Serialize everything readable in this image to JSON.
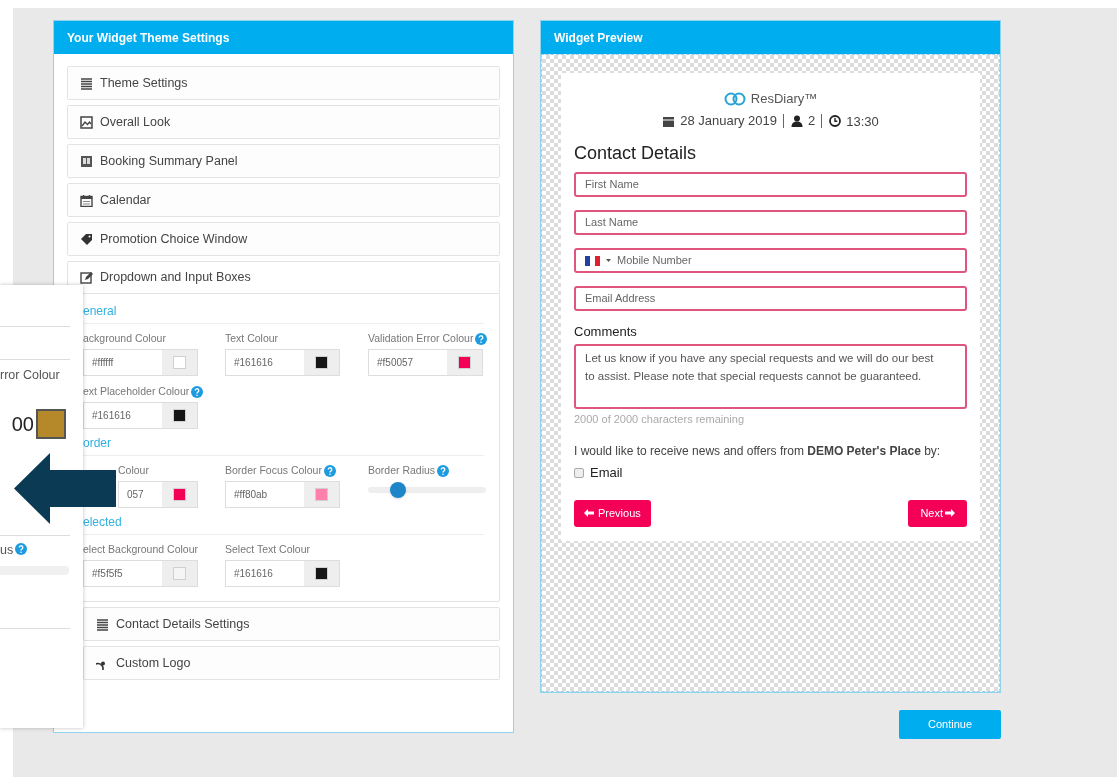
{
  "settings_panel": {
    "title": "Your Widget Theme Settings",
    "sections": [
      {
        "label": "Theme Settings",
        "expanded": false
      },
      {
        "label": "Overall Look",
        "expanded": false
      },
      {
        "label": "Booking Summary Panel",
        "expanded": false
      },
      {
        "label": "Calendar",
        "expanded": false
      },
      {
        "label": "Promotion Choice Window",
        "expanded": false
      },
      {
        "label": "Dropdown and Input Boxes",
        "expanded": true,
        "groups": [
          {
            "title": "eneral",
            "fields": [
              {
                "kind": "color",
                "label": "ackground Colour",
                "help": false,
                "value": "#ffffff",
                "color": "#ffffff"
              },
              {
                "kind": "color",
                "label": "Text Colour",
                "help": false,
                "value": "#161616",
                "color": "#161616"
              },
              {
                "kind": "color",
                "label": "Validation Error Colour",
                "help": true,
                "value": "#f50057",
                "color": "#f50057"
              },
              {
                "kind": "color",
                "label": "ext Placeholder Colour",
                "help": true,
                "value": "#161616",
                "color": "#161616"
              }
            ]
          },
          {
            "title": "order",
            "fields": [
              {
                "kind": "color_clipped",
                "label": "Colour",
                "help": false,
                "value": "057",
                "color": "#f50057"
              },
              {
                "kind": "color",
                "label": "Border Focus Colour",
                "help": true,
                "value": "#ff80ab",
                "color": "#ff80ab"
              },
              {
                "kind": "slider",
                "label": "Border Radius",
                "help": true,
                "level": 0.25
              }
            ]
          },
          {
            "title": "elected",
            "fields": [
              {
                "kind": "color",
                "label": "elect Background Colour",
                "help": false,
                "value": "#f5f5f5",
                "color": "#f5f5f5"
              },
              {
                "kind": "color",
                "label": "Select Text Colour",
                "help": false,
                "value": "#161616",
                "color": "#161616"
              }
            ]
          }
        ]
      },
      {
        "label": "Contact Details Settings",
        "expanded": false
      },
      {
        "label": "Custom Logo",
        "expanded": false
      }
    ]
  },
  "inset": {
    "label_1": "rror Colour",
    "value": "00",
    "color": "#b5892a",
    "label_2": "us",
    "help": true
  },
  "preview_panel": {
    "title": "Widget Preview",
    "logo_text": "ResDiary™",
    "date": "28 January 2019",
    "guests": "2",
    "time": "13:30",
    "heading": "Contact Details",
    "fields": [
      {
        "kind": "text",
        "placeholder": "First Name"
      },
      {
        "kind": "text",
        "placeholder": "Last Name"
      },
      {
        "kind": "phone",
        "placeholder": "Mobile Number"
      },
      {
        "kind": "text",
        "placeholder": "Email Address"
      }
    ],
    "comments_label": "Comments",
    "comments_placeholder": "Let us know if you have any special requests and we will do our best to assist. Please note that special requests cannot be guaranteed.",
    "counter": "2000 of 2000 characters remaining",
    "consent": "I would like to receive news and offers from **DEMO Peter's Place** by:",
    "email_option": {
      "label": "Email",
      "checked": false
    },
    "previous_button": "Previous",
    "next_button": "Next"
  },
  "continue_button": "Continue"
}
